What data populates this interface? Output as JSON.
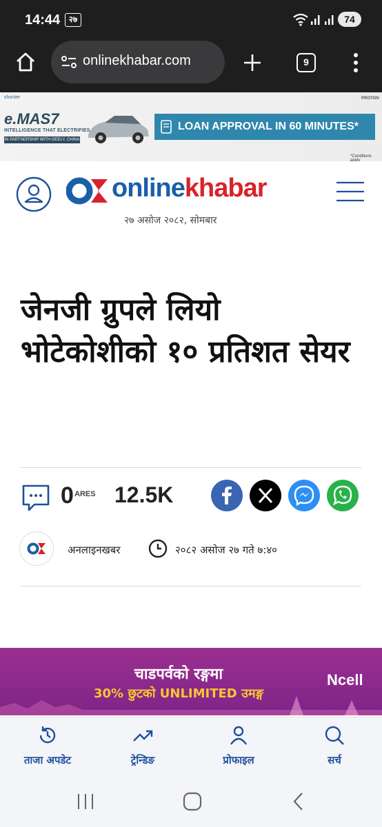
{
  "status_bar": {
    "time": "14:44",
    "date_badge": "२७",
    "battery": "74",
    "icons": [
      "wifi-icon",
      "signal-icon",
      "signal-icon",
      "battery-icon"
    ]
  },
  "browser": {
    "url": "onlinekhabar.com",
    "tab_count": "9",
    "icons": [
      "home-icon",
      "site-settings-icon",
      "new-tab-icon",
      "menu-icon"
    ]
  },
  "top_ad": {
    "sponsor": "shonter",
    "brand": "e.MAS7",
    "tagline": "INTELLIGENCE THAT ELECTRIFIES",
    "partner": "IN PARTNERSHIP WITH GEELY, CHINA",
    "loan_text": "LOAN APPROVAL IN 60 MINUTES*",
    "maker": "PROTON",
    "conditions": "*Conditions apply"
  },
  "site": {
    "logo_part1": "online",
    "logo_part2": "khabar",
    "date": "२७ असोज २०८२, सोमबार",
    "brand_colors": {
      "blue": "#1a5fa8",
      "red": "#d8232a"
    }
  },
  "article": {
    "headline": "जेनजी ग्रुपले लियो भोटेकोशीको १० प्रतिशत सेयर",
    "shares": "0",
    "shares_label": "ARES",
    "views": "12.5K",
    "author": "अनलाइनखबर",
    "published": "२०८२ असोज २७ गते ७:४०"
  },
  "social": [
    "facebook-icon",
    "x-icon",
    "messenger-icon",
    "whatsapp-icon"
  ],
  "ncell_ad": {
    "line1": "चाडपर्वको रङ्गमा",
    "line2": "30% छुटको UNLIMITED उमङ्ग",
    "brand": "Ncell"
  },
  "bottom_nav": [
    {
      "label": "ताजा अपडेट",
      "icon": "history-icon"
    },
    {
      "label": "ट्रेन्डिङ",
      "icon": "trending-icon"
    },
    {
      "label": "प्रोफाइल",
      "icon": "profile-icon"
    },
    {
      "label": "सर्च",
      "icon": "search-icon"
    }
  ]
}
